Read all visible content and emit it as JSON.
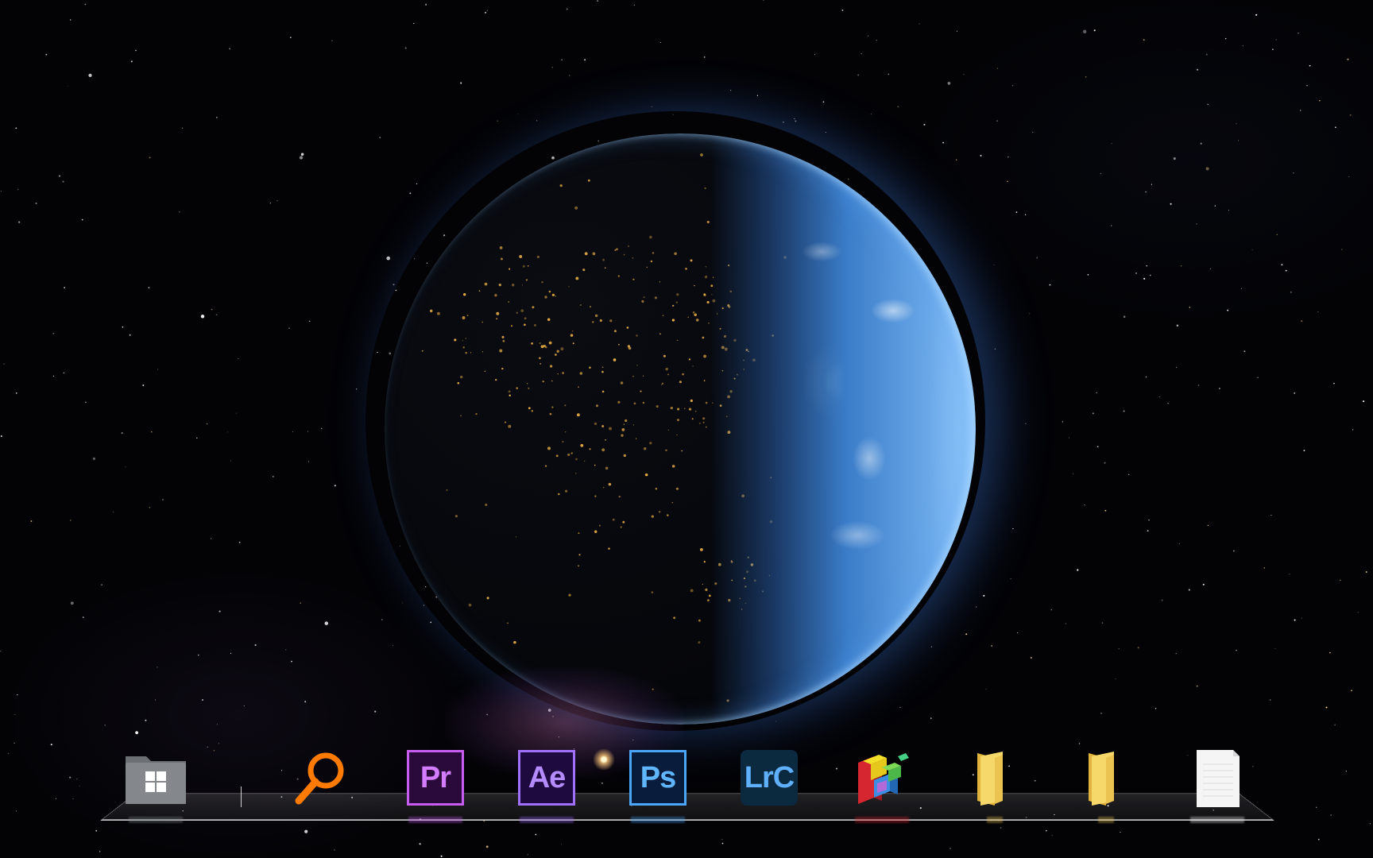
{
  "desktop": {
    "wallpaper": "earth-at-night-space"
  },
  "dock": {
    "items": [
      {
        "name": "explorer-folder",
        "icon": "folder-windows-icon",
        "color": "#7b7f84"
      },
      {
        "name": "search",
        "icon": "magnifier-icon",
        "color": "#ff7a00"
      },
      {
        "name": "premiere-pro",
        "icon": "premiere-pro-icon",
        "label": "Pr",
        "color": "#c85cf0"
      },
      {
        "name": "after-effects",
        "icon": "after-effects-icon",
        "label": "Ae",
        "color": "#a070ff"
      },
      {
        "name": "photoshop",
        "icon": "photoshop-icon",
        "label": "Ps",
        "color": "#4aa6ff"
      },
      {
        "name": "lightroom-classic",
        "icon": "lightroom-classic-icon",
        "label": "LrC",
        "color": "#5fb0ff"
      },
      {
        "name": "defraggler",
        "icon": "colored-blocks-icon"
      },
      {
        "name": "folder-1",
        "icon": "folder-icon",
        "color": "#f2cc5c"
      },
      {
        "name": "folder-2",
        "icon": "folder-icon",
        "color": "#f2cc5c"
      },
      {
        "name": "document",
        "icon": "blank-document-icon",
        "color": "#f4f4f4"
      }
    ]
  }
}
